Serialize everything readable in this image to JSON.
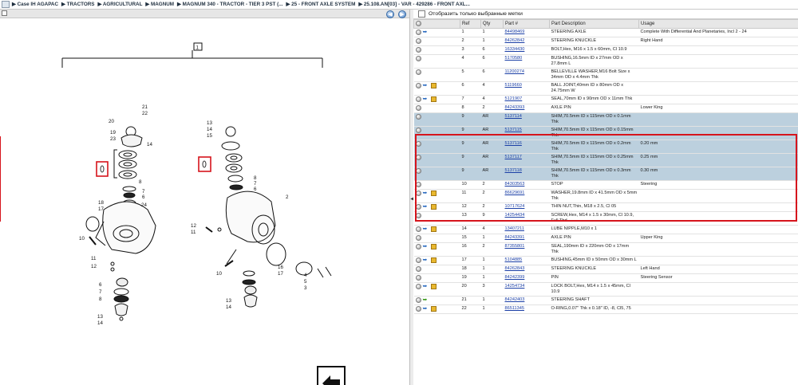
{
  "breadcrumb": [
    "Case IH AGAPAC",
    "TRACTORS",
    "AGRICULTURAL",
    "MAGNUM",
    "MAGNUM 340 - TRACTOR - TIER 3 PST (...",
    "25 - FRONT AXLE SYSTEM",
    "25.108.AN[03] - VAR - 429286 - FRONT AXL..."
  ],
  "filter_label": "Отобразить только выбранные метки",
  "table_headers": [
    "",
    "Ref",
    "Qty",
    "Part #",
    "Part Description",
    "Usage"
  ],
  "diagram": {
    "group_ref": "1",
    "left_callouts": [
      "21",
      "22",
      "20",
      "19",
      "23",
      "14",
      "8",
      "7",
      "6",
      "24",
      "18",
      "17",
      "10",
      "11",
      "12",
      "6",
      "7",
      "8",
      "13",
      "14"
    ],
    "right_callouts": [
      "13",
      "14",
      "15",
      "8",
      "7",
      "6",
      "2",
      "12",
      "11",
      "10",
      "16",
      "17",
      "4",
      "5",
      "3",
      "13",
      "14"
    ]
  },
  "rows": [
    {
      "icons": [
        "cir",
        "arr"
      ],
      "ref": "1",
      "qty": "1",
      "part": "84498469",
      "desc": "STEERING AXLE",
      "usage": "Complete With Differential And Planetaries, Incl 2 - 24"
    },
    {
      "icons": [
        "cir"
      ],
      "ref": "2",
      "qty": "1",
      "part": "84262842",
      "desc": "STEERING KNUCKLE",
      "usage": "Right Hand"
    },
    {
      "icons": [
        "cir"
      ],
      "ref": "3",
      "qty": "6",
      "part": "16334430",
      "desc": "BOLT,Hex, M16 x 1.5 x 60mm, Cl 10.9",
      "usage": ""
    },
    {
      "icons": [
        "cir"
      ],
      "ref": "4",
      "qty": "6",
      "part": "5170580",
      "desc": "BUSHING,16.5mm ID x 27mm OD x 27.8mm L",
      "usage": ""
    },
    {
      "icons": [
        "cir"
      ],
      "ref": "5",
      "qty": "6",
      "part": "11200274",
      "desc": "BELLEVILLE WASHER,M16 Bolt Size x 34mm OD x 4.4mm Thk",
      "usage": ""
    },
    {
      "icons": [
        "cir",
        "arr",
        "box"
      ],
      "ref": "6",
      "qty": "4",
      "part": "5119660",
      "desc": "BALL JOINT,40mm ID x 80mm OD x 24.75mm W",
      "usage": ""
    },
    {
      "icons": [
        "cir",
        "arr",
        "box"
      ],
      "ref": "7",
      "qty": "4",
      "part": "5121907",
      "desc": "SEAL,70mm ID x 90mm OD x 11mm Thk",
      "usage": ""
    },
    {
      "icons": [
        "cir"
      ],
      "ref": "8",
      "qty": "2",
      "part": "84243393",
      "desc": "AXLE PIN",
      "usage": "Lower King"
    },
    {
      "icons": [
        "cir"
      ],
      "ref": "9",
      "qty": "AR",
      "part": "5137114",
      "desc": "SHIM,70.5mm ID x 115mm OD x 0.1mm Thk",
      "usage": "",
      "sel": true
    },
    {
      "icons": [
        "cir"
      ],
      "ref": "9",
      "qty": "AR",
      "part": "5137115",
      "desc": "SHIM,70.5mm ID x 115mm OD x 0.15mm Thk",
      "usage": "",
      "sel": true
    },
    {
      "icons": [
        "cir"
      ],
      "ref": "9",
      "qty": "AR",
      "part": "5137116",
      "desc": "SHIM,70.5mm ID x 115mm OD x 0.2mm Thk",
      "usage": "0.20 mm",
      "sel": true
    },
    {
      "icons": [
        "cir"
      ],
      "ref": "9",
      "qty": "AR",
      "part": "5137117",
      "desc": "SHIM,70.5mm ID x 115mm OD x 0.25mm Thk",
      "usage": "0.25 mm",
      "sel": true
    },
    {
      "icons": [
        "cir"
      ],
      "ref": "9",
      "qty": "AR",
      "part": "5137118",
      "desc": "SHIM,70.5mm ID x 115mm OD x 0.3mm Thk",
      "usage": "0.30 mm",
      "sel": true
    },
    {
      "icons": [
        "cir"
      ],
      "ref": "10",
      "qty": "2",
      "part": "84303563",
      "desc": "STOP",
      "usage": "Steering"
    },
    {
      "icons": [
        "cir",
        "arr",
        "box"
      ],
      "ref": "11",
      "qty": "2",
      "part": "86629691",
      "desc": "WASHER,19.8mm ID x 41.5mm OD x 5mm Thk",
      "usage": ""
    },
    {
      "icons": [
        "cir",
        "arr",
        "box"
      ],
      "ref": "12",
      "qty": "2",
      "part": "10717624",
      "desc": "THIN NUT,Thin, M18 x 2.5, Cl 05",
      "usage": ""
    },
    {
      "icons": [
        "cir"
      ],
      "ref": "13",
      "qty": "9",
      "part": "14254434",
      "desc": "SCREW,Hex, M14 x 1.5 x 30mm, Cl 10.9, Full Thd",
      "usage": ""
    },
    {
      "icons": [
        "cir",
        "arr",
        "box"
      ],
      "ref": "14",
      "qty": "4",
      "part": "13407211",
      "desc": "LUBE NIPPLE,M10 x 1",
      "usage": ""
    },
    {
      "icons": [
        "cir"
      ],
      "ref": "15",
      "qty": "1",
      "part": "84243391",
      "desc": "AXLE PIN",
      "usage": "Upper King"
    },
    {
      "icons": [
        "cir",
        "arr",
        "box"
      ],
      "ref": "16",
      "qty": "2",
      "part": "87355801",
      "desc": "SEAL,190mm ID x 220mm OD x 17mm Thk",
      "usage": ""
    },
    {
      "icons": [
        "cir",
        "arr",
        "box"
      ],
      "ref": "17",
      "qty": "1",
      "part": "5104885",
      "desc": "BUSHING,45mm ID x 50mm OD x 30mm L",
      "usage": ""
    },
    {
      "icons": [
        "cir"
      ],
      "ref": "18",
      "qty": "1",
      "part": "84262843",
      "desc": "STEERING KNUCKLE",
      "usage": "Left Hand"
    },
    {
      "icons": [
        "cir"
      ],
      "ref": "19",
      "qty": "1",
      "part": "84242399",
      "desc": "PIN",
      "usage": "Steering Sensor"
    },
    {
      "icons": [
        "cir",
        "arr",
        "box"
      ],
      "ref": "20",
      "qty": "3",
      "part": "14254734",
      "desc": "LOCK BOLT,Hex, M14 x 1.5 x 45mm, Cl 10.9",
      "usage": ""
    },
    {
      "icons": [
        "cir",
        "green"
      ],
      "ref": "21",
      "qty": "1",
      "part": "84242403",
      "desc": "STEERING SHAFT",
      "usage": ""
    },
    {
      "icons": [
        "cir",
        "arr",
        "box"
      ],
      "ref": "22",
      "qty": "1",
      "part": "86511345",
      "desc": "O-RING,0.07\" Thk x 0.18\" ID, -8, Cl5, 75",
      "usage": ""
    }
  ]
}
